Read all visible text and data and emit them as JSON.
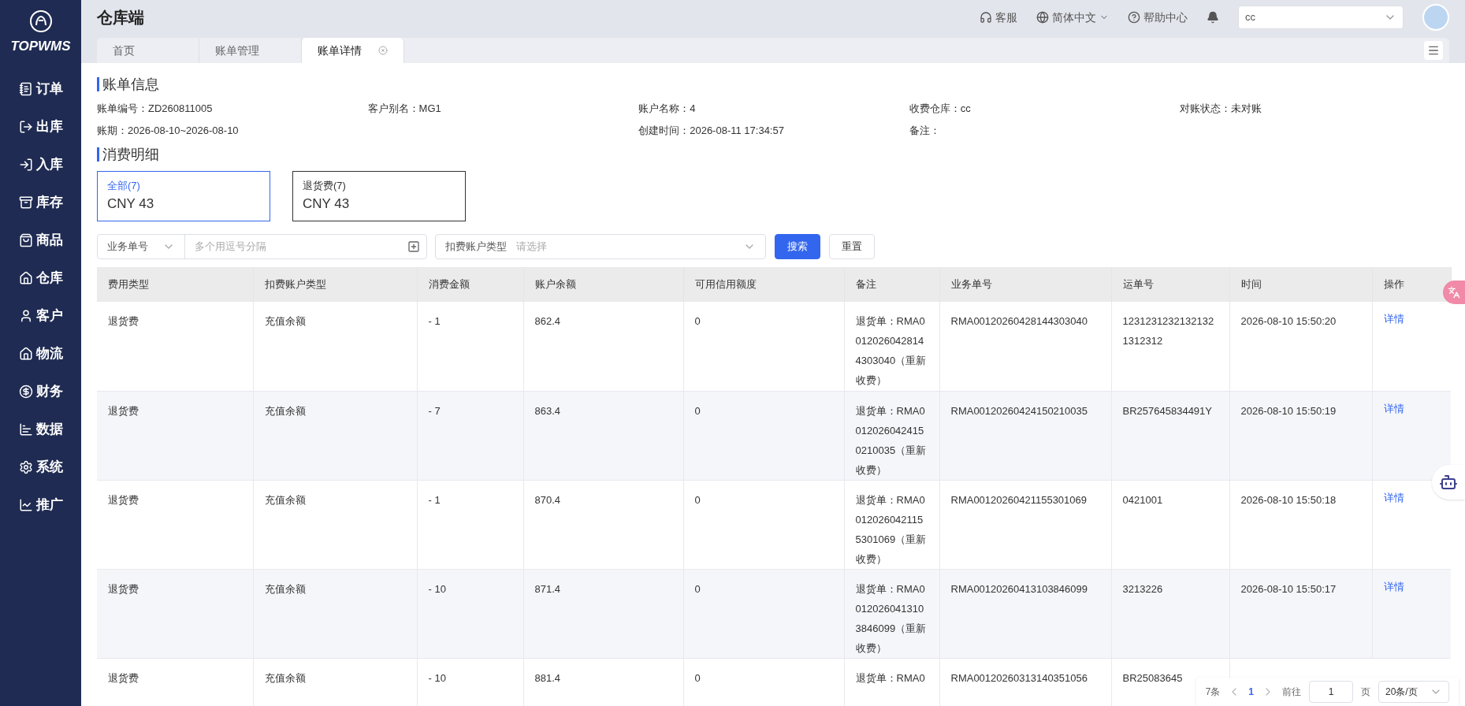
{
  "sidebar": {
    "logo": "TOPWMS",
    "items": [
      {
        "label": "订单"
      },
      {
        "label": "出库"
      },
      {
        "label": "入库"
      },
      {
        "label": "库存"
      },
      {
        "label": "商品"
      },
      {
        "label": "仓库"
      },
      {
        "label": "客户"
      },
      {
        "label": "物流"
      },
      {
        "label": "财务"
      },
      {
        "label": "数据"
      },
      {
        "label": "系统"
      },
      {
        "label": "推广"
      }
    ]
  },
  "header": {
    "title": "仓库端",
    "links": [
      {
        "kind": "service",
        "label": "客服"
      },
      {
        "kind": "language",
        "label": "简体中文"
      },
      {
        "kind": "help",
        "label": "帮助中心"
      }
    ],
    "warehouse_select": {
      "value": "cc"
    }
  },
  "tabs": [
    {
      "label": "首页",
      "selected": false
    },
    {
      "label": "账单管理",
      "selected": false
    },
    {
      "label": "账单详情",
      "selected": true
    }
  ],
  "bill_info": {
    "title": "账单信息",
    "rows": [
      [
        {
          "label": "账单编号：",
          "value": "ZD260811005"
        },
        {
          "label": "客户别名：",
          "value": "MG1"
        },
        {
          "label": "账户名称：",
          "value": "4"
        },
        {
          "label": "收费仓库：",
          "value": "cc"
        },
        {
          "label": "对账状态：",
          "value": "未对账"
        }
      ],
      [
        {
          "label": "账期：",
          "value": "2026-08-10~2026-08-10"
        },
        null,
        {
          "label": "创建时间：",
          "value": "2026-08-11 17:34:57"
        },
        {
          "label": "备注："
        },
        null
      ]
    ]
  },
  "details": {
    "title": "消费明细",
    "cards": [
      {
        "label": "全部(7)",
        "amount": "CNY 43",
        "selected": true
      },
      {
        "label": "退货费(7)",
        "amount": "CNY 43",
        "selected": false
      }
    ]
  },
  "filters": {
    "field_select": "业务单号",
    "input_placeholder": "多个用逗号分隔",
    "account_select": {
      "label": "扣费账户类型",
      "placeholder": "请选择"
    },
    "buttons": [
      {
        "kind": "primary",
        "label": "搜索"
      },
      {
        "kind": "default",
        "label": "重置"
      }
    ]
  },
  "table": {
    "columns": [
      "费用类型",
      "扣费账户类型",
      "消费金额",
      "账户余额",
      "可用信用额度",
      "备注",
      "业务单号",
      "运单号",
      "时间",
      "操作"
    ],
    "rows": [
      {
        "cells": [
          "退货费",
          "充值余额",
          "- 1",
          "862.4",
          "0",
          "退货单：RMA0012026042814 4303040（重新收费）",
          "RMA00120260428144303040",
          "12312312321321321312312",
          "2026-08-10 15:50:20"
        ],
        "action": "详情"
      },
      {
        "cells": [
          "退货费",
          "充值余额",
          "- 7",
          "863.4",
          "0",
          "退货单：RMA0012026042415 0210035（重新收费）",
          "RMA00120260424150210035",
          "BR257645834491Y",
          "2026-08-10 15:50:19"
        ],
        "action": "详情"
      },
      {
        "cells": [
          "退货费",
          "充值余额",
          "- 1",
          "870.4",
          "0",
          "退货单：RMA0012026042115 5301069（重新收费）",
          "RMA00120260421155301069",
          "0421001",
          "2026-08-10 15:50:18"
        ],
        "action": "详情"
      },
      {
        "cells": [
          "退货费",
          "充值余额",
          "- 10",
          "871.4",
          "0",
          "退货单：RMA0012026041310 3846099（重新收费）",
          "RMA00120260413103846099",
          "3213226",
          "2026-08-10 15:50:17"
        ],
        "action": "详情"
      },
      {
        "cells": [
          "退货费",
          "充值余额",
          "- 10",
          "881.4",
          "0",
          "退货单：RMA0",
          "RMA00120260313140351056",
          "BR25083645"
        ]
      }
    ]
  },
  "pagination": {
    "total": "7条",
    "pages": [
      {
        "label": "1",
        "selected": true
      }
    ],
    "goto_label": "前往",
    "goto_value": "1",
    "page_unit": "页",
    "page_size": "20条/页"
  }
}
